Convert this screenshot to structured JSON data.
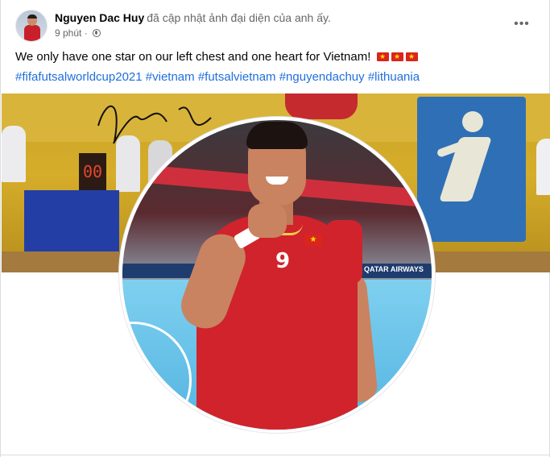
{
  "post": {
    "author": "Nguyen Dac Huy",
    "action": "đã cập nhật ảnh đại diện của anh ấy.",
    "time": "9 phút",
    "privacy_icon": "globe-icon",
    "more_label": "•••",
    "caption": "We only have one star on our left chest and one heart for Vietnam!",
    "caption_emoji": [
      "vietnam-flag",
      "vietnam-flag",
      "vietnam-flag"
    ],
    "hashtags": [
      "#fifafutsalworldcup2021",
      "#vietnam",
      "#futsalvietnam",
      "#nguyendachuy",
      "#lithuania"
    ]
  },
  "cover": {
    "scoreboard": "00"
  },
  "profile": {
    "jersey_number": "9",
    "ad_text": "QATAR AIRWAYS"
  },
  "colors": {
    "link": "#216fdb",
    "text_primary": "#050505",
    "text_secondary": "#65676b",
    "jersey_red": "#d1232c"
  }
}
